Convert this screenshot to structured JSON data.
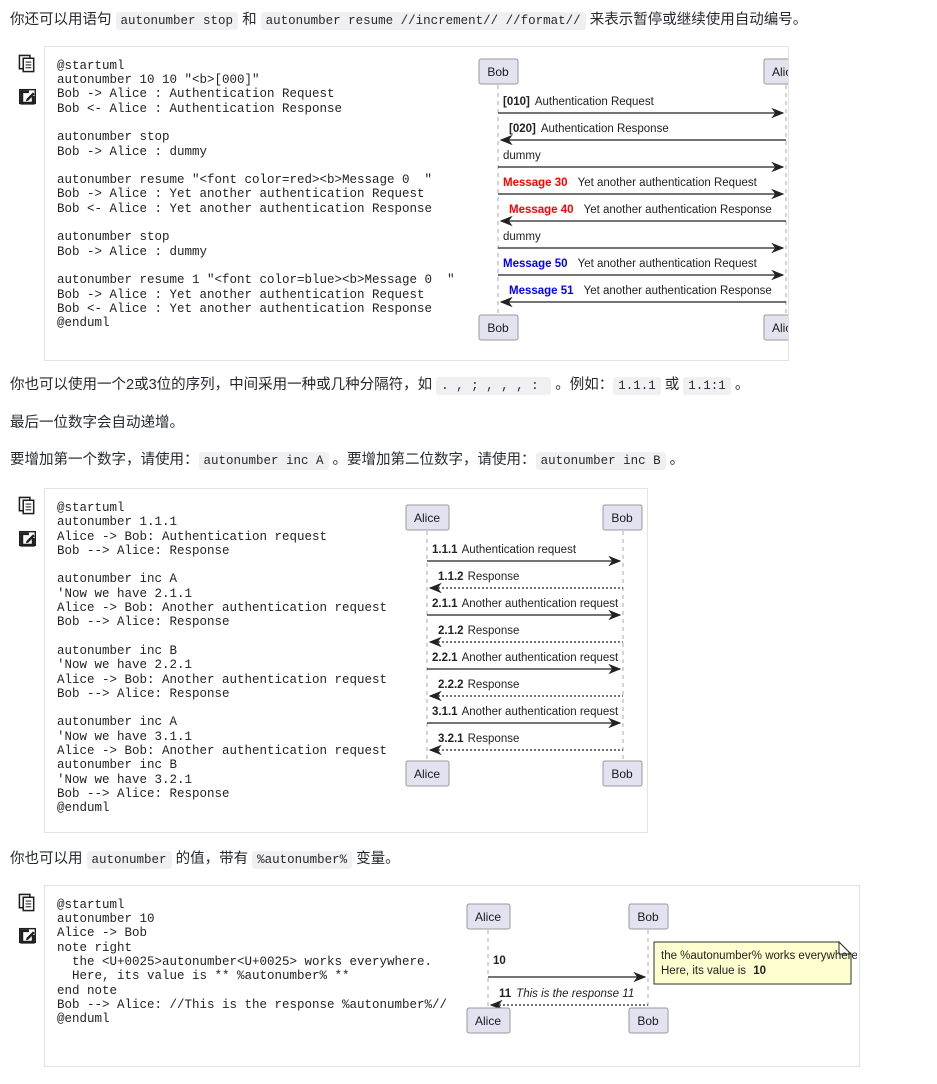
{
  "paragraphs": {
    "p1_a": "你还可以用语句 ",
    "p1_code1": "autonumber stop",
    "p1_b": " 和 ",
    "p1_code2": "autonumber resume //increment// //format//",
    "p1_c": " 来表示暂停或继续使用自动编号。",
    "p2_a": "你也可以使用一个2或3位的序列，中间采用一种或几种分隔符，如 ",
    "p2_code1": ". , ; , , , : ",
    "p2_b": " 。例如：",
    "p2_code2": "1.1.1",
    "p2_c": " 或 ",
    "p2_code3": "1.1:1",
    "p2_d": " 。",
    "p3": "最后一位数字会自动递增。",
    "p4_a": "要增加第一个数字，请使用：",
    "p4_code1": "autonumber inc A",
    "p4_b": " 。要增加第二位数字，请使用：",
    "p4_code2": "autonumber inc B",
    "p4_c": " 。",
    "p5_a": "你也可以用 ",
    "p5_code1": "autonumber",
    "p5_b": " 的值，带有 ",
    "p5_code2": "%autonumber%",
    "p5_c": " 变量。"
  },
  "gutter": {
    "copy_icon": "copy-icon",
    "edit_icon": "edit-icon"
  },
  "blocks": [
    {
      "id": "block-1",
      "code": "@startuml\nautonumber 10 10 \"<b>[000]\"\nBob -> Alice : Authentication Request\nBob <- Alice : Authentication Response\n\nautonumber stop\nBob -> Alice : dummy\n\nautonumber resume \"<font color=red><b>Message 0  \"\nBob -> Alice : Yet another authentication Request\nBob <- Alice : Yet another authentication Response\n\nautonumber stop\nBob -> Alice : dummy\n\nautonumber resume 1 \"<font color=blue><b>Message 0  \"\nBob -> Alice : Yet another authentication Request\nBob <- Alice : Yet another authentication Response\n@enduml",
      "diagram": {
        "left_actor": "Bob",
        "right_actor": "Alice",
        "messages": [
          {
            "num": "[010]",
            "numcolor": "#000000",
            "text": "Authentication Request",
            "dir": "right",
            "style": "solid"
          },
          {
            "num": "[020]",
            "numcolor": "#000000",
            "text": "Authentication Response",
            "dir": "left",
            "style": "solid"
          },
          {
            "num": "",
            "numcolor": "#000000",
            "text": "dummy",
            "dir": "right",
            "style": "solid"
          },
          {
            "num": "Message 30",
            "numcolor": "#FF0000",
            "text": "Yet another authentication Request",
            "dir": "right",
            "style": "solid"
          },
          {
            "num": "Message 40",
            "numcolor": "#FF0000",
            "text": "Yet another authentication Response",
            "dir": "left",
            "style": "solid"
          },
          {
            "num": "",
            "numcolor": "#000000",
            "text": "dummy",
            "dir": "right",
            "style": "solid"
          },
          {
            "num": "Message 50",
            "numcolor": "#0000FF",
            "text": "Yet another authentication Request",
            "dir": "right",
            "style": "solid"
          },
          {
            "num": "Message 51",
            "numcolor": "#0000FF",
            "text": "Yet another authentication Response",
            "dir": "left",
            "style": "solid"
          }
        ]
      }
    },
    {
      "id": "block-2",
      "code": "@startuml\nautonumber 1.1.1\nAlice -> Bob: Authentication request\nBob --> Alice: Response\n\nautonumber inc A\n'Now we have 2.1.1\nAlice -> Bob: Another authentication request\nBob --> Alice: Response\n\nautonumber inc B\n'Now we have 2.2.1\nAlice -> Bob: Another authentication request\nBob --> Alice: Response\n\nautonumber inc A\n'Now we have 3.1.1\nAlice -> Bob: Another authentication request\nautonumber inc B\n'Now we have 3.2.1\nBob --> Alice: Response\n@enduml",
      "diagram": {
        "left_actor": "Alice",
        "right_actor": "Bob",
        "messages": [
          {
            "num": "1.1.1",
            "numcolor": "#000000",
            "text": "Authentication request",
            "dir": "right",
            "style": "solid"
          },
          {
            "num": "1.1.2",
            "numcolor": "#000000",
            "text": "Response",
            "dir": "left",
            "style": "dashed"
          },
          {
            "num": "2.1.1",
            "numcolor": "#000000",
            "text": "Another authentication request",
            "dir": "right",
            "style": "solid"
          },
          {
            "num": "2.1.2",
            "numcolor": "#000000",
            "text": "Response",
            "dir": "left",
            "style": "dashed"
          },
          {
            "num": "2.2.1",
            "numcolor": "#000000",
            "text": "Another authentication request",
            "dir": "right",
            "style": "solid"
          },
          {
            "num": "2.2.2",
            "numcolor": "#000000",
            "text": "Response",
            "dir": "left",
            "style": "dashed"
          },
          {
            "num": "3.1.1",
            "numcolor": "#000000",
            "text": "Another authentication request",
            "dir": "right",
            "style": "solid"
          },
          {
            "num": "3.2.1",
            "numcolor": "#000000",
            "text": "Response",
            "dir": "left",
            "style": "dashed"
          }
        ]
      }
    },
    {
      "id": "block-3",
      "code": "@startuml\nautonumber 10\nAlice -> Bob\nnote right\n  the <U+0025>autonumber<U+0025> works everywhere.\n  Here, its value is ** %autonumber% **\nend note\nBob --> Alice: //This is the response %autonumber%//\n@enduml",
      "diagram": {
        "left_actor": "Alice",
        "right_actor": "Bob",
        "messages": [
          {
            "num": "10",
            "numcolor": "#000000",
            "text": "",
            "dir": "right",
            "style": "solid"
          },
          {
            "num": "11",
            "numcolor": "#000000",
            "text": "This is the response 11",
            "dir": "left",
            "style": "dashed",
            "italic": true
          }
        ],
        "note": {
          "line1": "the %autonumber% works everywhere.",
          "line2_a": "Here, its value is ",
          "line2_b": "10"
        }
      }
    }
  ],
  "colors": {
    "actor_fill": "#e2e2f0",
    "actor_stroke": "#999999",
    "note_fill": "#fefece",
    "note_stroke": "#30302f",
    "red": "#FF0000",
    "blue": "#0000FF",
    "panel_border": "#e3e3e3",
    "inline_code_bg": "#f0f0f2"
  }
}
